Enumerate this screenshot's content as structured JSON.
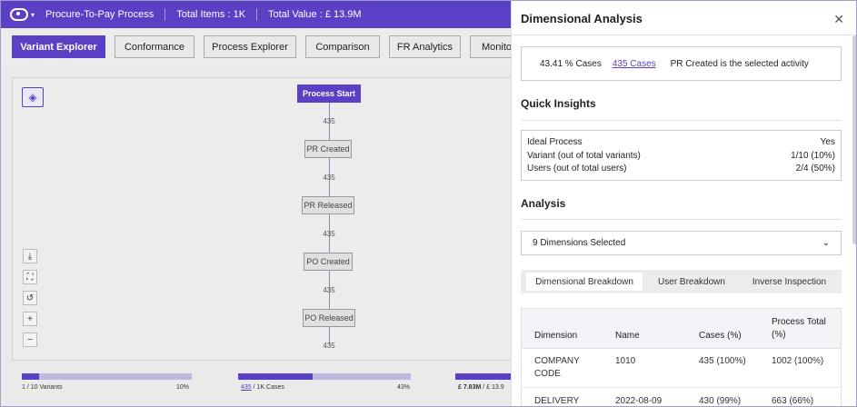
{
  "topbar": {
    "process_name": "Procure-To-Pay Process",
    "total_items": "Total Items : 1K",
    "total_value": "Total Value : £ 13.9M"
  },
  "nav_tabs": [
    {
      "label": "Variant Explorer",
      "active": true
    },
    {
      "label": "Conformance"
    },
    {
      "label": "Process Explorer"
    },
    {
      "label": "Comparison"
    },
    {
      "label": "FR Analytics"
    },
    {
      "label": "Monito"
    }
  ],
  "process_map": {
    "nodes": [
      "Process Start",
      "PR Created",
      "PR Released",
      "PO Created",
      "PO Released"
    ],
    "edge_label": "435"
  },
  "stats": {
    "variants_left": "1",
    "variants_right": " / 10 Variants",
    "variants_pct": "10%",
    "variants_fraction": 0.1,
    "cases_link": "435",
    "cases_right": " / 1K Cases",
    "cases_pct": "43%",
    "cases_fraction": 0.43,
    "value_left": "£ 7.83M",
    "value_right": " / £ 13.9"
  },
  "panel": {
    "title": "Dimensional Analysis",
    "close_icon": "✕",
    "summary": {
      "pct_cases": "43.41 % Cases",
      "cases_link": "435 Cases",
      "activity_text": "PR Created is the selected activity"
    },
    "quick_insights_title": "Quick Insights",
    "insights": [
      {
        "label": "Ideal Process",
        "value": "Yes"
      },
      {
        "label": "Variant (out of total variants)",
        "value": "1/10  (10%)"
      },
      {
        "label": "Users (out of total users)",
        "value": "2/4  (50%)"
      }
    ],
    "analysis_title": "Analysis",
    "dimensions_select": "9 Dimensions Selected",
    "subtabs": [
      {
        "label": "Dimensional Breakdown",
        "active": true
      },
      {
        "label": "User Breakdown"
      },
      {
        "label": "Inverse Inspection"
      }
    ],
    "table": {
      "headers": [
        "Dimension",
        "Name",
        "Cases (%)",
        "Process Total (%)"
      ],
      "rows": [
        [
          "COMPANY CODE",
          "1010",
          "435 (100%)",
          "1002 (100%)"
        ],
        [
          "DELIVERY",
          "2022-08-09",
          "430 (99%)",
          "663 (66%)"
        ]
      ]
    }
  }
}
